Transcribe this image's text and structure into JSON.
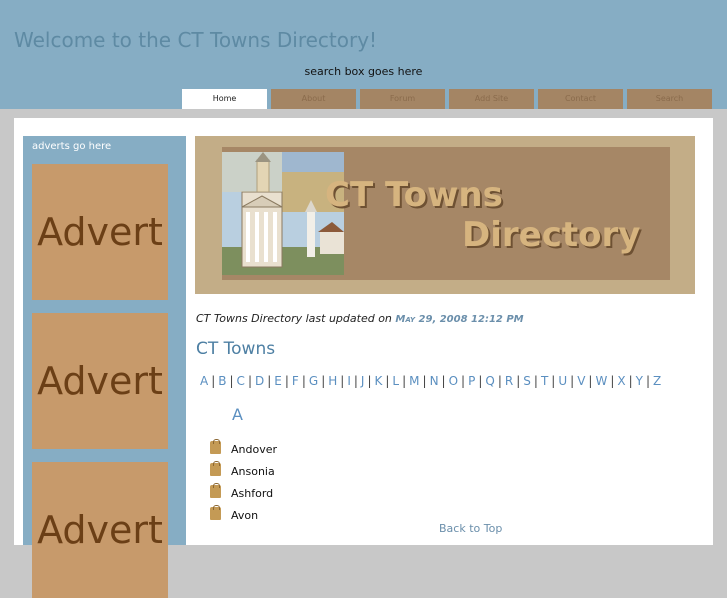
{
  "header": {
    "title": "Welcome to the CT Towns Directory!",
    "search_note": "search box goes here"
  },
  "nav": [
    "Home",
    "About",
    "Forum",
    "Add Site",
    "Contact",
    "Search"
  ],
  "sidebar": {
    "ad_note": "adverts go here",
    "adverts": [
      "Advert",
      "Advert",
      "Advert"
    ]
  },
  "banner": {
    "line1": "CT Towns",
    "line2": "Directory"
  },
  "main": {
    "updated_prefix": "CT Towns Directory last updated on ",
    "updated_date": "May 29, 2008 12:12 PM",
    "section_title": "CT Towns",
    "alphabet": [
      "A",
      "B",
      "C",
      "D",
      "E",
      "F",
      "G",
      "H",
      "I",
      "J",
      "K",
      "L",
      "M",
      "N",
      "O",
      "P",
      "Q",
      "R",
      "S",
      "T",
      "U",
      "V",
      "W",
      "X",
      "Y",
      "Z"
    ],
    "current_letter": "A",
    "towns": [
      "Andover",
      "Ansonia",
      "Ashford",
      "Avon"
    ],
    "back_to_top": "Back to Top"
  },
  "colors": {
    "header_bg": "#86adc4",
    "tab_bg": "#a48564",
    "advert_bg": "#c79a6b",
    "link": "#5b8fc0"
  }
}
